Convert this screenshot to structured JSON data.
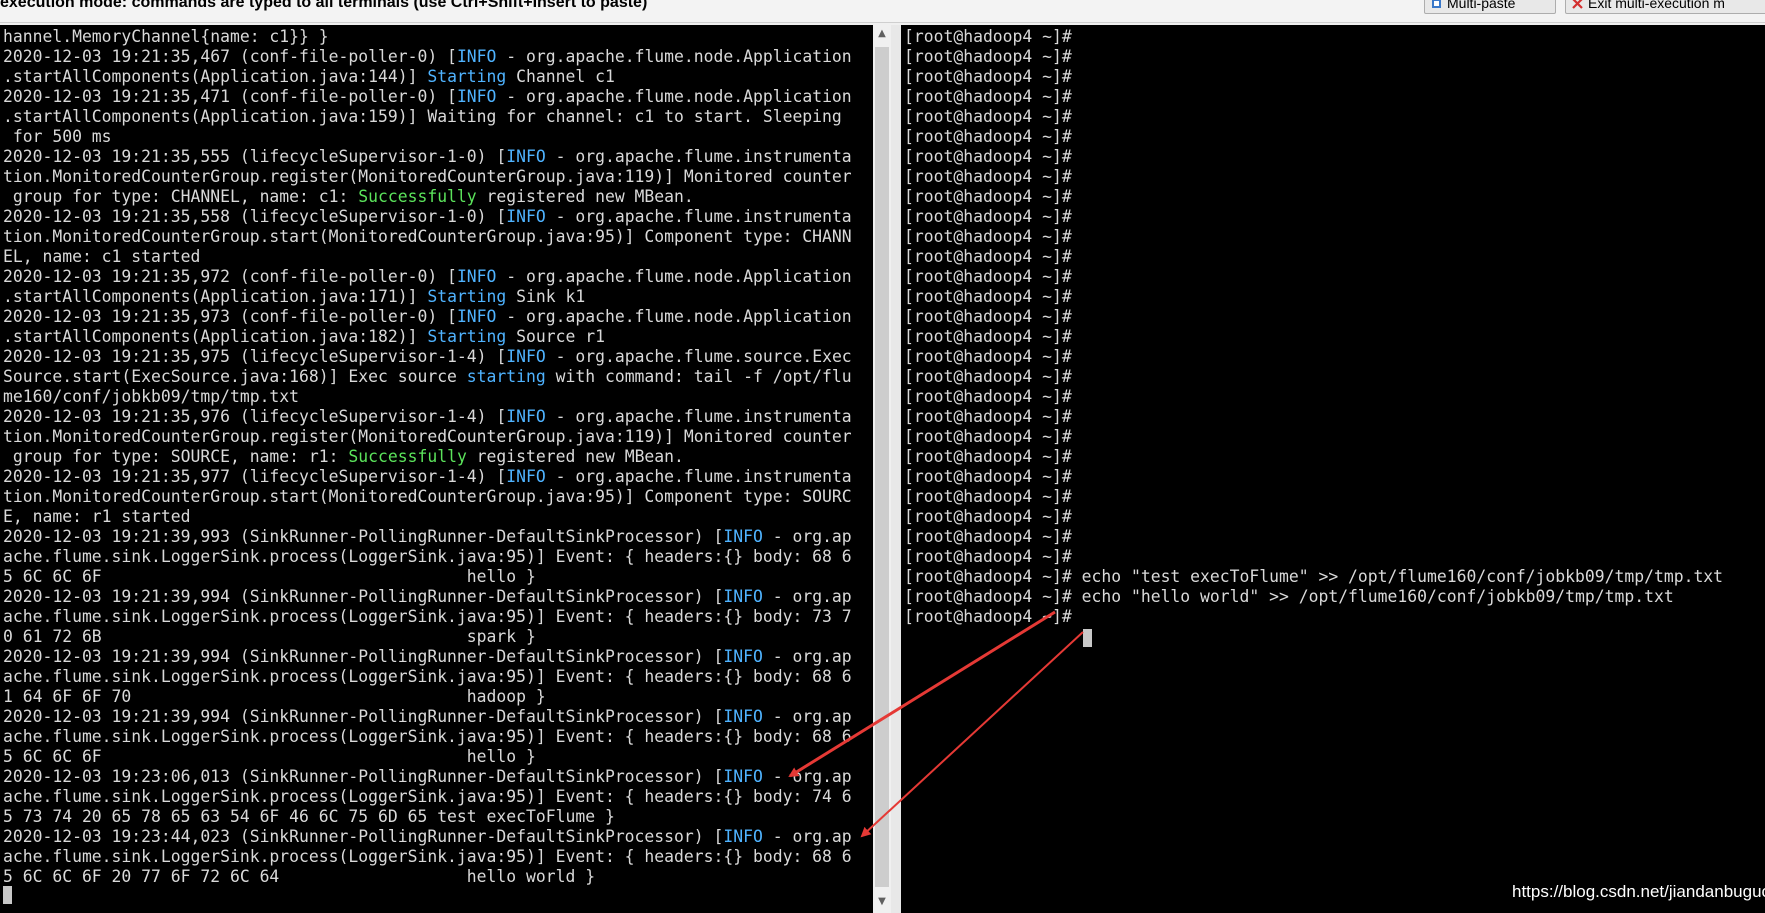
{
  "topbar": {
    "mode_text": "execution mode: commands are typed to all terminals (use Ctrl+Shift+Insert to paste)",
    "multipaste_label": "Multi-paste",
    "exit_label": "Exit multi-execution m"
  },
  "left_terminal": {
    "lines": [
      [
        {
          "t": "hannel.MemoryChannel{name: c1}} }"
        }
      ],
      [
        {
          "t": "2020-12-03 19:21:35,467 (conf-file-poller-0) ["
        },
        {
          "t": "INFO",
          "c": "info"
        },
        {
          "t": " - org.apache.flume.node.Application"
        }
      ],
      [
        {
          "t": ".startAllComponents(Application.java:144)] "
        },
        {
          "t": "Starting",
          "c": "start"
        },
        {
          "t": " Channel c1"
        }
      ],
      [
        {
          "t": "2020-12-03 19:21:35,471 (conf-file-poller-0) ["
        },
        {
          "t": "INFO",
          "c": "info"
        },
        {
          "t": " - org.apache.flume.node.Application"
        }
      ],
      [
        {
          "t": ".startAllComponents(Application.java:159)] Waiting for channel: c1 to start. Sleeping"
        }
      ],
      [
        {
          "t": " for 500 ms"
        }
      ],
      [
        {
          "t": "2020-12-03 19:21:35,555 (lifecycleSupervisor-1-0) ["
        },
        {
          "t": "INFO",
          "c": "info"
        },
        {
          "t": " - org.apache.flume.instrumenta"
        }
      ],
      [
        {
          "t": "tion.MonitoredCounterGroup.register(MonitoredCounterGroup.java:119)] Monitored counter"
        }
      ],
      [
        {
          "t": " group for type: CHANNEL, name: c1: "
        },
        {
          "t": "Successfully",
          "c": "ok"
        },
        {
          "t": " registered new MBean."
        }
      ],
      [
        {
          "t": "2020-12-03 19:21:35,558 (lifecycleSupervisor-1-0) ["
        },
        {
          "t": "INFO",
          "c": "info"
        },
        {
          "t": " - org.apache.flume.instrumenta"
        }
      ],
      [
        {
          "t": "tion.MonitoredCounterGroup.start(MonitoredCounterGroup.java:95)] Component type: CHANN"
        }
      ],
      [
        {
          "t": "EL, name: c1 started"
        }
      ],
      [
        {
          "t": "2020-12-03 19:21:35,972 (conf-file-poller-0) ["
        },
        {
          "t": "INFO",
          "c": "info"
        },
        {
          "t": " - org.apache.flume.node.Application"
        }
      ],
      [
        {
          "t": ".startAllComponents(Application.java:171)] "
        },
        {
          "t": "Starting",
          "c": "start"
        },
        {
          "t": " Sink k1"
        }
      ],
      [
        {
          "t": "2020-12-03 19:21:35,973 (conf-file-poller-0) ["
        },
        {
          "t": "INFO",
          "c": "info"
        },
        {
          "t": " - org.apache.flume.node.Application"
        }
      ],
      [
        {
          "t": ".startAllComponents(Application.java:182)] "
        },
        {
          "t": "Starting",
          "c": "start"
        },
        {
          "t": " Source r1"
        }
      ],
      [
        {
          "t": "2020-12-03 19:21:35,975 (lifecycleSupervisor-1-4) ["
        },
        {
          "t": "INFO",
          "c": "info"
        },
        {
          "t": " - org.apache.flume.source.Exec"
        }
      ],
      [
        {
          "t": "Source.start(ExecSource.java:168)] Exec source "
        },
        {
          "t": "starting",
          "c": "start"
        },
        {
          "t": " with command: tail -f /opt/flu"
        }
      ],
      [
        {
          "t": "me160/conf/jobkb09/tmp/tmp.txt"
        }
      ],
      [
        {
          "t": "2020-12-03 19:21:35,976 (lifecycleSupervisor-1-4) ["
        },
        {
          "t": "INFO",
          "c": "info"
        },
        {
          "t": " - org.apache.flume.instrumenta"
        }
      ],
      [
        {
          "t": "tion.MonitoredCounterGroup.register(MonitoredCounterGroup.java:119)] Monitored counter"
        }
      ],
      [
        {
          "t": " group for type: SOURCE, name: r1: "
        },
        {
          "t": "Successfully",
          "c": "ok"
        },
        {
          "t": " registered new MBean."
        }
      ],
      [
        {
          "t": "2020-12-03 19:21:35,977 (lifecycleSupervisor-1-4) ["
        },
        {
          "t": "INFO",
          "c": "info"
        },
        {
          "t": " - org.apache.flume.instrumenta"
        }
      ],
      [
        {
          "t": "tion.MonitoredCounterGroup.start(MonitoredCounterGroup.java:95)] Component type: SOURC"
        }
      ],
      [
        {
          "t": "E, name: r1 started"
        }
      ],
      [
        {
          "t": "2020-12-03 19:21:39,993 (SinkRunner-PollingRunner-DefaultSinkProcessor) ["
        },
        {
          "t": "INFO",
          "c": "info"
        },
        {
          "t": " - org.ap"
        }
      ],
      [
        {
          "t": "ache.flume.sink.LoggerSink.process(LoggerSink.java:95)] Event: { headers:{} body: 68 6"
        }
      ],
      [
        {
          "t": "5 6C 6C 6F                                     hello }"
        }
      ],
      [
        {
          "t": "2020-12-03 19:21:39,994 (SinkRunner-PollingRunner-DefaultSinkProcessor) ["
        },
        {
          "t": "INFO",
          "c": "info"
        },
        {
          "t": " - org.ap"
        }
      ],
      [
        {
          "t": "ache.flume.sink.LoggerSink.process(LoggerSink.java:95)] Event: { headers:{} body: 73 7"
        }
      ],
      [
        {
          "t": "0 61 72 6B                                     spark }"
        }
      ],
      [
        {
          "t": "2020-12-03 19:21:39,994 (SinkRunner-PollingRunner-DefaultSinkProcessor) ["
        },
        {
          "t": "INFO",
          "c": "info"
        },
        {
          "t": " - org.ap"
        }
      ],
      [
        {
          "t": "ache.flume.sink.LoggerSink.process(LoggerSink.java:95)] Event: { headers:{} body: 68 6"
        }
      ],
      [
        {
          "t": "1 64 6F 6F 70                                  hadoop }"
        }
      ],
      [
        {
          "t": "2020-12-03 19:21:39,994 (SinkRunner-PollingRunner-DefaultSinkProcessor) ["
        },
        {
          "t": "INFO",
          "c": "info"
        },
        {
          "t": " - org.ap"
        }
      ],
      [
        {
          "t": "ache.flume.sink.LoggerSink.process(LoggerSink.java:95)] Event: { headers:{} body: 68 6"
        }
      ],
      [
        {
          "t": "5 6C 6C 6F                                     hello }"
        }
      ],
      [
        {
          "t": "2020-12-03 19:23:06,013 (SinkRunner-PollingRunner-DefaultSinkProcessor) ["
        },
        {
          "t": "INFO",
          "c": "info"
        },
        {
          "t": " - org.ap"
        }
      ],
      [
        {
          "t": "ache.flume.sink.LoggerSink.process(LoggerSink.java:95)] Event: { headers:{} body: 74 6"
        }
      ],
      [
        {
          "t": "5 73 74 20 65 78 65 63 54 6F 46 6C 75 6D 65 test execToFlume }"
        }
      ],
      [
        {
          "t": "2020-12-03 19:23:44,023 (SinkRunner-PollingRunner-DefaultSinkProcessor) ["
        },
        {
          "t": "INFO",
          "c": "info"
        },
        {
          "t": " - org.ap"
        }
      ],
      [
        {
          "t": "ache.flume.sink.LoggerSink.process(LoggerSink.java:95)] Event: { headers:{} body: 68 6"
        }
      ],
      [
        {
          "t": "5 6C 6C 6F 20 77 6F 72 6C 64                   hello world }"
        }
      ]
    ]
  },
  "right_terminal": {
    "lines": [
      [
        {
          "t": "[root@hadoop4 ~]#"
        }
      ],
      [
        {
          "t": "[root@hadoop4 ~]#"
        }
      ],
      [
        {
          "t": "[root@hadoop4 ~]#"
        }
      ],
      [
        {
          "t": "[root@hadoop4 ~]#"
        }
      ],
      [
        {
          "t": "[root@hadoop4 ~]#"
        }
      ],
      [
        {
          "t": "[root@hadoop4 ~]#"
        }
      ],
      [
        {
          "t": "[root@hadoop4 ~]#"
        }
      ],
      [
        {
          "t": "[root@hadoop4 ~]#"
        }
      ],
      [
        {
          "t": "[root@hadoop4 ~]#"
        }
      ],
      [
        {
          "t": "[root@hadoop4 ~]#"
        }
      ],
      [
        {
          "t": "[root@hadoop4 ~]#"
        }
      ],
      [
        {
          "t": "[root@hadoop4 ~]#"
        }
      ],
      [
        {
          "t": "[root@hadoop4 ~]#"
        }
      ],
      [
        {
          "t": "[root@hadoop4 ~]#"
        }
      ],
      [
        {
          "t": "[root@hadoop4 ~]#"
        }
      ],
      [
        {
          "t": "[root@hadoop4 ~]#"
        }
      ],
      [
        {
          "t": "[root@hadoop4 ~]#"
        }
      ],
      [
        {
          "t": "[root@hadoop4 ~]#"
        }
      ],
      [
        {
          "t": "[root@hadoop4 ~]#"
        }
      ],
      [
        {
          "t": "[root@hadoop4 ~]#"
        }
      ],
      [
        {
          "t": "[root@hadoop4 ~]#"
        }
      ],
      [
        {
          "t": "[root@hadoop4 ~]#"
        }
      ],
      [
        {
          "t": "[root@hadoop4 ~]#"
        }
      ],
      [
        {
          "t": "[root@hadoop4 ~]#"
        }
      ],
      [
        {
          "t": "[root@hadoop4 ~]#"
        }
      ],
      [
        {
          "t": "[root@hadoop4 ~]#"
        }
      ],
      [
        {
          "t": "[root@hadoop4 ~]#"
        }
      ],
      [
        {
          "t": "[root@hadoop4 ~]# echo \"test execToFlume\" >> /opt/flume160/conf/jobkb09/tmp/tmp.txt"
        }
      ],
      [
        {
          "t": "[root@hadoop4 ~]# echo \"hello world\" >> /opt/flume160/conf/jobkb09/tmp/tmp.txt"
        }
      ],
      [
        {
          "t": "[root@hadoop4 ~]# "
        }
      ]
    ]
  },
  "watermark": "https://blog.csdn.net/jiandanbuguo",
  "colors": {
    "terminal_bg": "#000000",
    "terminal_fg": "#d9d9d9",
    "info": "#4fb3ff",
    "success": "#5be35b",
    "annotation_arrow": "#e53935"
  }
}
